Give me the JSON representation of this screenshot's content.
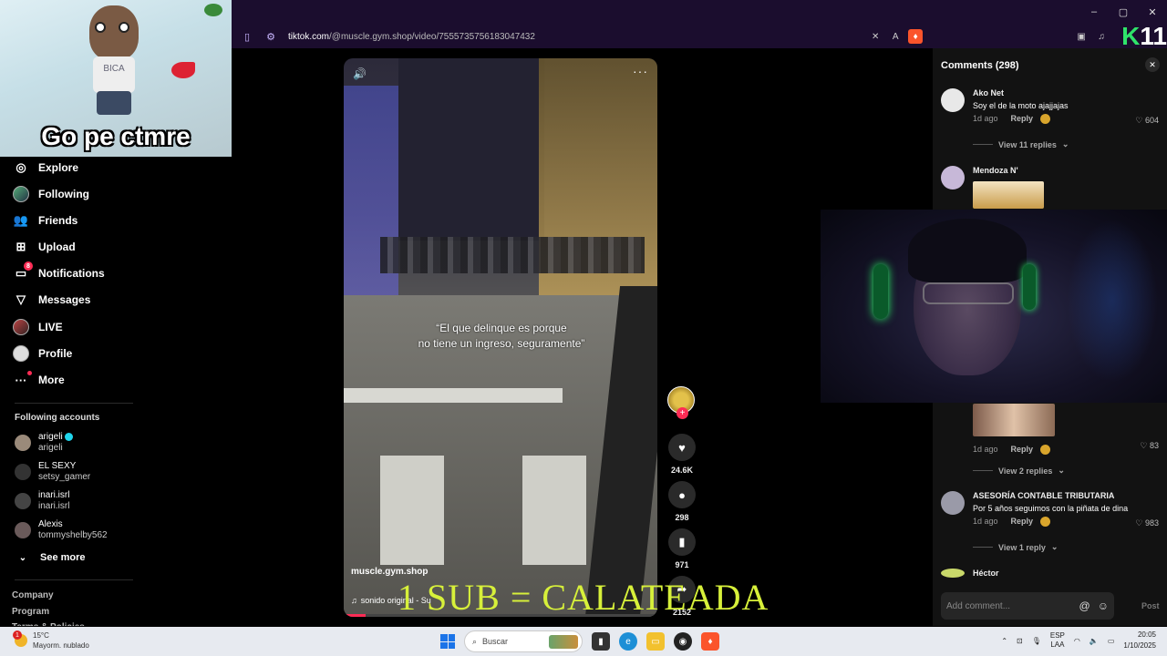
{
  "browser": {
    "url_domain": "tiktok.com",
    "url_path": "/@muscle.gym.shop/video/7555735756183047432",
    "window_controls": [
      "–",
      "▢",
      "✕"
    ]
  },
  "sticker": {
    "caption": "Go pe ctmre",
    "shirt_text": "BICA"
  },
  "overlay_logo": {
    "k": "K",
    "num": "11"
  },
  "nav": {
    "items": [
      {
        "label": "Explore",
        "icon": "compass-icon"
      },
      {
        "label": "Following",
        "icon": "avatar"
      },
      {
        "label": "Friends",
        "icon": "friends-icon"
      },
      {
        "label": "Upload",
        "icon": "upload-icon"
      },
      {
        "label": "Notifications",
        "icon": "notifications-icon",
        "badge": "8"
      },
      {
        "label": "Messages",
        "icon": "messages-icon"
      },
      {
        "label": "LIVE",
        "icon": "live-avatar"
      },
      {
        "label": "Profile",
        "icon": "profile-avatar"
      },
      {
        "label": "More",
        "icon": "more-icon"
      }
    ],
    "following_title": "Following accounts",
    "accounts": [
      {
        "name": "arigeli",
        "user": "arigeli"
      },
      {
        "name": "EL SEXY",
        "user": "setsy_gamer"
      },
      {
        "name": "inari.isrl",
        "user": "inari.isrl"
      },
      {
        "name": "Alexis",
        "user": "tommyshelby562"
      }
    ],
    "see_more": "See more",
    "footer": [
      "Company",
      "Program",
      "Terms & Policies"
    ]
  },
  "video": {
    "quote_line1": "“El que delinque es porque",
    "quote_line2": "no tiene un ingreso, seguramente”",
    "author": "muscle.gym.shop",
    "sound": "sonido original - Su",
    "progress": 0.07
  },
  "actions": {
    "likes": "24.6K",
    "comments": "298",
    "saves": "971",
    "shares": "2152"
  },
  "overlay_caption": "1 SUB = CALATEADA",
  "comments_panel": {
    "title": "Comments (298)",
    "items": [
      {
        "name": "Ako Net",
        "text": "Soy el de la moto ajajjajas",
        "time": "1d ago",
        "reply": "Reply",
        "likes": "604",
        "replies": "View 11 replies"
      },
      {
        "name": "Mendoza N'",
        "text": "",
        "time": "",
        "reply": "",
        "likes": "",
        "replies": ""
      },
      {
        "name": "",
        "text": "",
        "time": "1d ago",
        "reply": "Reply",
        "likes": "83",
        "replies": "View 2 replies"
      },
      {
        "name": "ASESORÍA CONTABLE TRIBUTARIA",
        "text": "Por 5 años seguimos con la piñata de dina",
        "time": "1d ago",
        "reply": "Reply",
        "likes": "983",
        "replies": "View 1 reply"
      },
      {
        "name": "Héctor",
        "text": "",
        "time": "",
        "reply": "",
        "likes": "",
        "replies": ""
      }
    ],
    "add_placeholder": "Add comment...",
    "post": "Post"
  },
  "taskbar": {
    "temp": "15°C",
    "weather": "Mayorm. nublado",
    "weather_badge": "1",
    "search": "Buscar",
    "lang1": "ESP",
    "lang2": "LAA",
    "time": "20:05",
    "date": "1/10/2025"
  },
  "colors": {
    "accent": "#fe2c55",
    "caption": "#d7f03a",
    "topbar": "#1b0d2e"
  }
}
